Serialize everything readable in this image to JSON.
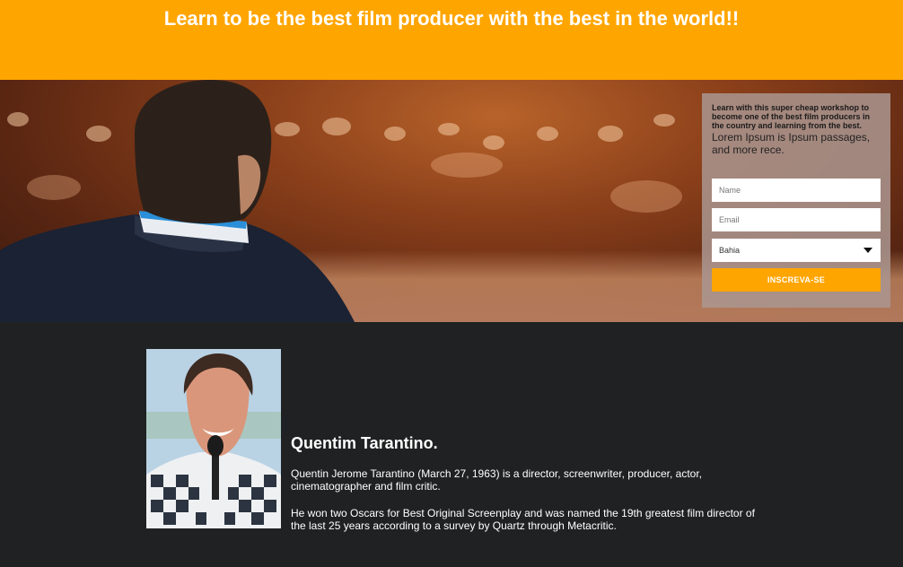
{
  "header": {
    "title": "Learn to be the best film producer with the best in the world!!"
  },
  "signup": {
    "intro": "Learn with this super cheap workshop to become one of the best film producers in the country and learning from the best.",
    "lorem": "Lorem Ipsum is Ipsum passages, and more rece.",
    "name_placeholder": "Name",
    "email_placeholder": "Email",
    "state_selected": "Bahia",
    "submit_label": "INSCREVA-SE"
  },
  "bio": {
    "name": "Quentim Tarantino.",
    "paragraph1": "Quentin Jerome Tarantino (March 27, 1963) is a director, screenwriter, producer, actor, cinematographer and film critic.",
    "paragraph2": "He won two Oscars for Best Original Screenplay and was named the 19th greatest film director of the last 25 years according to a survey by Quartz through Metacritic."
  },
  "colors": {
    "accent": "#ffa500",
    "dark_bg": "#1f2122"
  }
}
